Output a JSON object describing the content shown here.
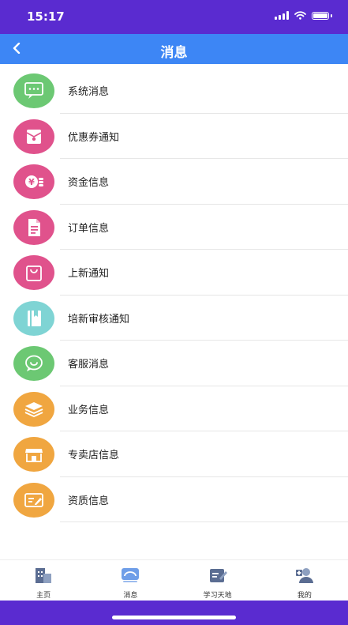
{
  "status": {
    "time": "15:17"
  },
  "header": {
    "title": "消息",
    "back_icon": "chevron-left-icon"
  },
  "messages": [
    {
      "label": "系统消息",
      "icon": "chat-dots-icon",
      "color": "#6cc873"
    },
    {
      "label": "优惠券通知",
      "icon": "coupon-icon",
      "color": "#e0528c"
    },
    {
      "label": "资金信息",
      "icon": "money-icon",
      "color": "#e0528c"
    },
    {
      "label": "订单信息",
      "icon": "document-icon",
      "color": "#e0528c"
    },
    {
      "label": "上新通知",
      "icon": "shopping-bag-icon",
      "color": "#e0528c"
    },
    {
      "label": "培新审核通知",
      "icon": "book-icon",
      "color": "#7fd4d4"
    },
    {
      "label": "客服消息",
      "icon": "chat-bubble-icon",
      "color": "#6cc873"
    },
    {
      "label": "业务信息",
      "icon": "layers-icon",
      "color": "#f0a640"
    },
    {
      "label": "专卖店信息",
      "icon": "store-icon",
      "color": "#f0a640"
    },
    {
      "label": "资质信息",
      "icon": "certificate-icon",
      "color": "#f0a640"
    }
  ],
  "tabbar": [
    {
      "label": "主页",
      "icon": "home-building-icon"
    },
    {
      "label": "消息",
      "icon": "message-icon"
    },
    {
      "label": "学习天地",
      "icon": "study-icon"
    },
    {
      "label": "我的",
      "icon": "profile-icon"
    }
  ]
}
